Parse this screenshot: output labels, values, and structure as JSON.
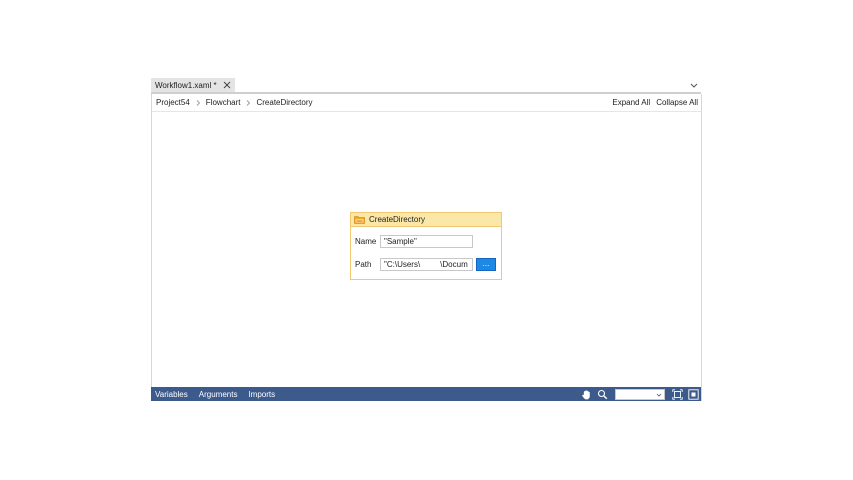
{
  "tab": {
    "title": "Workflow1.xaml *"
  },
  "breadcrumb": {
    "items": [
      "Project54",
      "Flowchart",
      "CreateDirectory"
    ]
  },
  "bar_actions": {
    "expand_all": "Expand All",
    "collapse_all": "Collapse All"
  },
  "activity": {
    "title": "CreateDirectory",
    "icon": "folder-activity-icon",
    "name_label": "Name",
    "name_value": "\"Sample\"",
    "path_label": "Path",
    "path_value": "\"C:\\Users\\         \\Docum",
    "browse_label": "..."
  },
  "bottom_bar": {
    "variables": "Variables",
    "arguments": "Arguments",
    "imports": "Imports",
    "zoom_value": ""
  },
  "colors": {
    "accent": "#1e88e5",
    "bottom_bar": "#3c5a8c",
    "activity_header": "#fbe7a8",
    "activity_border": "#f2c870"
  }
}
